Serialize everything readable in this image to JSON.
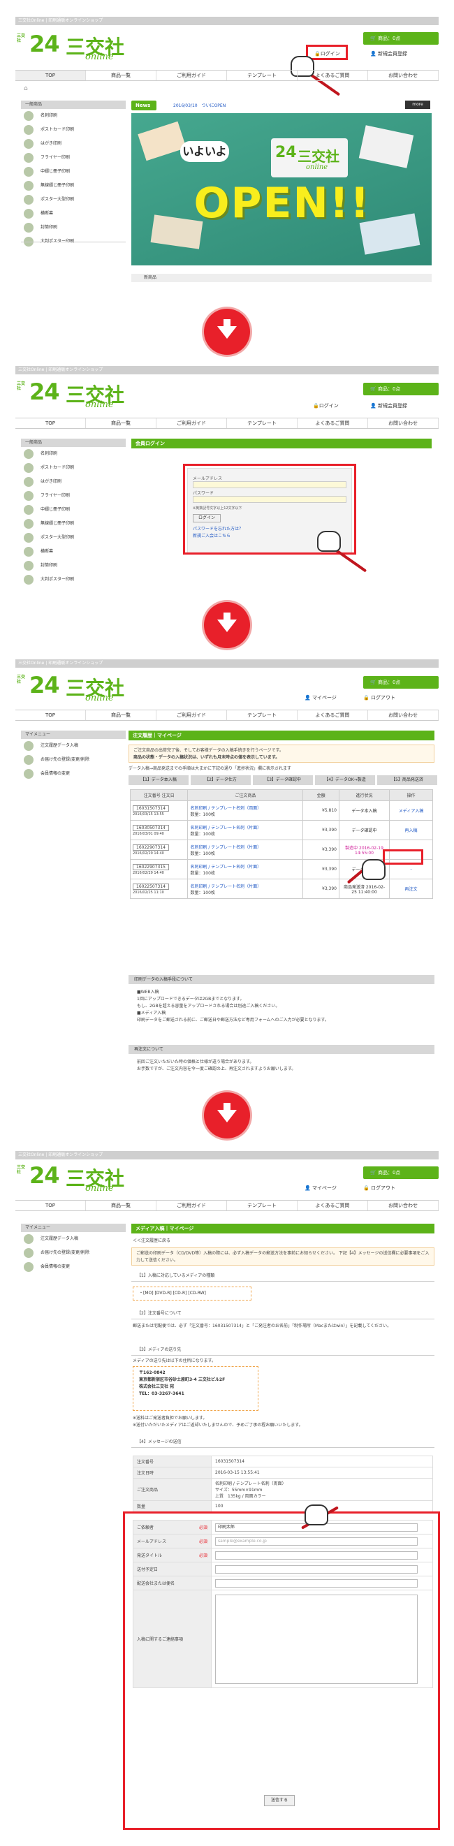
{
  "common": {
    "topbar": "三交社Online | 印刷通販オンラインショップ",
    "logo_small": "三交社",
    "logo_num": "24",
    "logo_name": "三交社",
    "logo_online": "online",
    "cart": "商品：0点",
    "login": "ログイン",
    "register": "新規会員登録",
    "mypage": "マイページ",
    "logout": "ログアウト",
    "nav": [
      "TOP",
      "商品一覧",
      "ご利用ガイド",
      "テンプレート",
      "よくあるご質問",
      "お問い合わせ"
    ]
  },
  "s1": {
    "side_header": "一般商品",
    "side_items": [
      "名刺印刷",
      "ポストカード印刷",
      "はがき印刷",
      "フライヤー印刷",
      "中綴じ冊子印刷",
      "無線綴じ冊子印刷",
      "ポスター大型印刷",
      "横断幕",
      "封筒印刷",
      "大判ポスター印刷"
    ],
    "news_tag": "News",
    "news_text": "2016/03/10　ついにOPEN",
    "more": "more",
    "banner_iyo": "いよいよ",
    "banner_open": "OPEN!!",
    "new_items": "新商品"
  },
  "s2": {
    "side_header": "一般商品",
    "side_items": [
      "名刺印刷",
      "ポストカード印刷",
      "はがき印刷",
      "フライヤー印刷",
      "中綴じ冊子印刷",
      "無線綴じ冊子印刷",
      "ポスター大型印刷",
      "横断幕",
      "封筒印刷",
      "大判ポスター印刷"
    ],
    "login_header": "会員ログイン",
    "email_label": "メールアドレス",
    "password_label": "パスワード",
    "hint": "※英数記号文字以上12文字以下",
    "login_btn": "ログイン",
    "forgot": "パスワードを忘れた方は？",
    "signup": "新規ご入会はこちら"
  },
  "s3": {
    "side_header": "マイメニュー",
    "side_items": [
      "注文履歴データ入稿",
      "お届け先の登録/変更/削除",
      "会員情報の変更"
    ],
    "title": "注文履歴｜マイページ",
    "notice1": "ご注文商品の出荷完了後、そしてお客様データの入稿手続きを行うページです。",
    "notice2": "商品の状態・データの入稿状況は、いずれも月末時点の値を表示しています。",
    "flow": "データ入稿→商品発送までの手順は大まかに下記の通り「進捗状況」欄に表示されます",
    "tabs": [
      "【1】データ本入稿",
      "【2】データ仕方",
      "【3】データ確認中",
      "【4】データOK→製造",
      "【5】商品発送済"
    ],
    "th": [
      "注文番号\n注文日",
      "ご注文商品",
      "金額",
      "進行状況",
      "操作"
    ],
    "rows": [
      {
        "no": "16031507314",
        "date": "2016/03/15 13:55",
        "item": "名刺印刷 / テンプレート名刺（両面）",
        "qty": "数量：100枚",
        "price": "¥5,810",
        "status": "データ本入稿",
        "op": "メディア入稿"
      },
      {
        "no": "16030507314",
        "date": "2016/03/01 09:40",
        "item": "名刺印刷 / テンプレート名刺（片面）",
        "qty": "数量：100枚",
        "price": "¥3,390",
        "status": "データ確認中",
        "op": "再入稿"
      },
      {
        "no": "16022907314",
        "date": "2016/02/29 14:40",
        "item": "名刺印刷 / テンプレート名刺（片面）",
        "qty": "数量：100枚",
        "price": "¥3,390",
        "status": "製造中 2016-02-19 14:55:00",
        "op": "-"
      },
      {
        "no": "16022907315",
        "date": "2016/02/29 14:40",
        "item": "名刺印刷 / テンプレート名刺（片面）",
        "qty": "数量：100枚",
        "price": "¥3,390",
        "status": "データ確認済",
        "op": "-"
      },
      {
        "no": "16022507314",
        "date": "2016/02/25 11:10",
        "item": "名刺印刷 / テンプレート名刺（片面）",
        "qty": "数量：100枚",
        "price": "¥3,390",
        "status": "商品発送済 2016-02-25 11:40:00",
        "op": "再注文"
      }
    ],
    "sec1": "印刷データの入稿手段について",
    "sec1_body": [
      "■WEB入稿",
      "1回にアップロードできるデータは2GBまでとなります。",
      "もし、2GBを超える容量をアップロードされる場合は別途ご入稿ください。",
      "■メディア入稿",
      "印刷データをご郵送される前に、ご郵送日や郵送方法など専用フォームへのご入力が必要となります。"
    ],
    "sec2": "再注文について",
    "sec2_body": [
      "前回ご注文いただいた時の価格と仕様が違う場合があります。",
      "お手数ですが、ご注文内容を今一度ご確認の上、再注文されますようお願いします。"
    ]
  },
  "s4": {
    "side_header": "マイメニュー",
    "side_items": [
      "注文履歴データ入稿",
      "お届け先の登録/変更/削除",
      "会員情報の変更"
    ],
    "title": "メディア入稿｜マイページ",
    "back": "＜＜注文履歴に戻る",
    "notice": "ご郵送の印刷データ（CD/DVD等）入稿の際には、必ず入稿データの郵送方法を事前にお知らせください。 下記【4】メッセージの送信欄に必要事項をご入力して送信ください。",
    "sec1": "【1】入稿に対応しているメディアの種類",
    "media": "・[MO] [DVD-R] [CD-R] [CD-RW]",
    "sec2": "【2】注文番号について",
    "sec2_body": "郵送または宅配便では、必ず「注文番号：16031507314」と「ご発注者のお名前」「制作場所（Macまたはwin）」を記載してください。",
    "sec3": "【3】メディアの送り先",
    "sec3_intro": "メディアの送り先は以下の住所になります。",
    "addr": [
      "〒162-0842",
      "東京都新宿区市谷砂土原町3-4 三交社ビル2F",
      "株式会社三交社 宛",
      "TEL：03-3267-3641"
    ],
    "sec3_note1": "※送料はご発送者負担でお願いします。",
    "sec3_note2": "※送付いただいたメディアはご返却いたしませんので、予めご了承の程お願いいたします。",
    "sec4": "【4】メッセージの送信",
    "info_labels": [
      "注文番号",
      "注文日時",
      "ご注文商品",
      "数量"
    ],
    "info_values": [
      "16031507314",
      "2016-03-15 13:55:41",
      "名刺印刷 / テンプレート名刺（両面）",
      "100"
    ],
    "info_extra": [
      "サイズ：55mm×91mm",
      "上質　135kg / 両面カラー"
    ],
    "form_labels": [
      "ご依頼者",
      "メールアドレス",
      "発送タイトル",
      "送付予定日",
      "配送会社または便名",
      "入稿に関するご連絡事項"
    ],
    "required": "必須",
    "form_values": [
      "印刷太郎",
      "sample@example.co.jp",
      "",
      "",
      "",
      ""
    ],
    "send": "送信する"
  }
}
